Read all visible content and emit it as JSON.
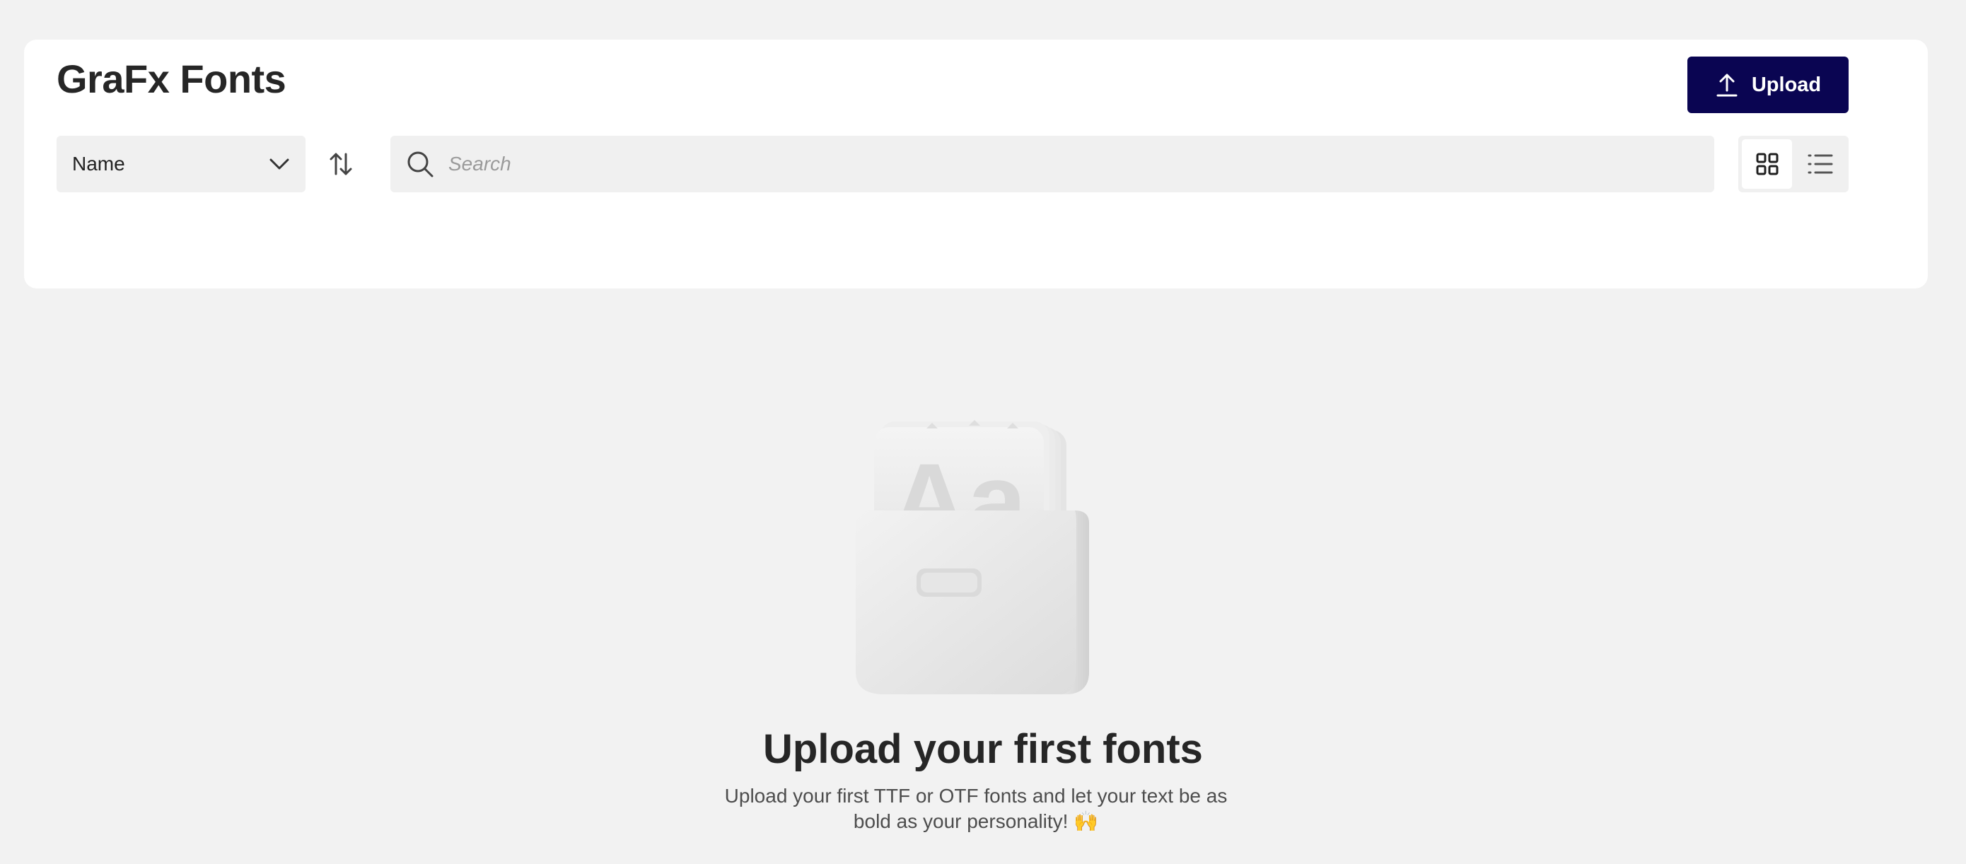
{
  "header": {
    "title": "GraFx Fonts",
    "upload_label": "Upload"
  },
  "toolbar": {
    "sort_select_value": "Name",
    "search_placeholder": "Search",
    "search_value": "",
    "view_mode": "grid"
  },
  "icons": {
    "upload": "upload-icon",
    "chevron": "chevron-down-icon",
    "sort": "sort-direction-icon",
    "search": "search-icon",
    "grid": "grid-view-icon",
    "list": "list-view-icon"
  },
  "colors": {
    "accent": "#0a0552",
    "background": "#f2f2f2",
    "card": "#ffffff",
    "field": "#f0f0f0"
  },
  "empty_state": {
    "illustration_text": "Aa",
    "title": "Upload your first fonts",
    "description": "Upload your first TTF or OTF fonts and let your text be as bold as your personality! 🙌"
  }
}
